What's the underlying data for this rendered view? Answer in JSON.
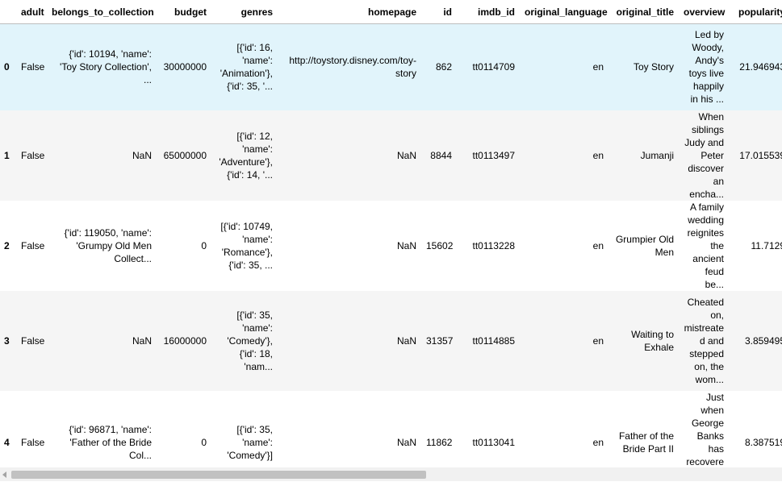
{
  "columns": [
    "",
    "adult",
    "belongs_to_collection",
    "budget",
    "genres",
    "homepage",
    "id",
    "imdb_id",
    "original_language",
    "original_title",
    "overview",
    "popularity",
    ""
  ],
  "rows": [
    [
      "0",
      "False",
      "{'id': 10194, 'name': 'Toy Story Collection', ...",
      "30000000",
      "[{'id': 16, 'name': 'Animation'}, {'id': 35, '...",
      "http://toystory.disney.com/toy-story",
      "862",
      "tt0114709",
      "en",
      "Toy Story",
      "Led by Woody, Andy's toys live happily in his ...",
      "21.946943",
      ""
    ],
    [
      "1",
      "False",
      "NaN",
      "65000000",
      "[{'id': 12, 'name': 'Adventure'}, {'id': 14, '...",
      "NaN",
      "8844",
      "tt0113497",
      "en",
      "Jumanji",
      "When siblings Judy and Peter discover an encha...",
      "17.015539",
      ""
    ],
    [
      "2",
      "False",
      "{'id': 119050, 'name': 'Grumpy Old Men Collect...",
      "0",
      "[{'id': 10749, 'name': 'Romance'}, {'id': 35, ...",
      "NaN",
      "15602",
      "tt0113228",
      "en",
      "Grumpier Old Men",
      "A family wedding reignites the ancient feud be...",
      "11.7129",
      ""
    ],
    [
      "3",
      "False",
      "NaN",
      "16000000",
      "[{'id': 35, 'name': 'Comedy'}, {'id': 18, 'nam...",
      "NaN",
      "31357",
      "tt0114885",
      "en",
      "Waiting to Exhale",
      "Cheated on, mistreated and stepped on, the wom...",
      "3.859495",
      "/"
    ],
    [
      "4",
      "False",
      "{'id': 96871, 'name': 'Father of the Bride Col...",
      "0",
      "[{'id': 35, 'name': 'Comedy'}]",
      "NaN",
      "11862",
      "tt0113041",
      "en",
      "Father of the Bride Part II",
      "Just when George Banks has recovered from his ...",
      "8.387519",
      ""
    ]
  ],
  "column_names": [
    "index",
    "adult",
    "belongs-to-collection",
    "budget",
    "genres",
    "homepage",
    "id",
    "imdb-id",
    "original-language",
    "original-title",
    "overview",
    "popularity",
    "next-column"
  ],
  "colors": {
    "hover_row": "#e1f4fb",
    "striped_row": "#f5f5f5",
    "scroll_thumb": "#c1c1c1"
  }
}
